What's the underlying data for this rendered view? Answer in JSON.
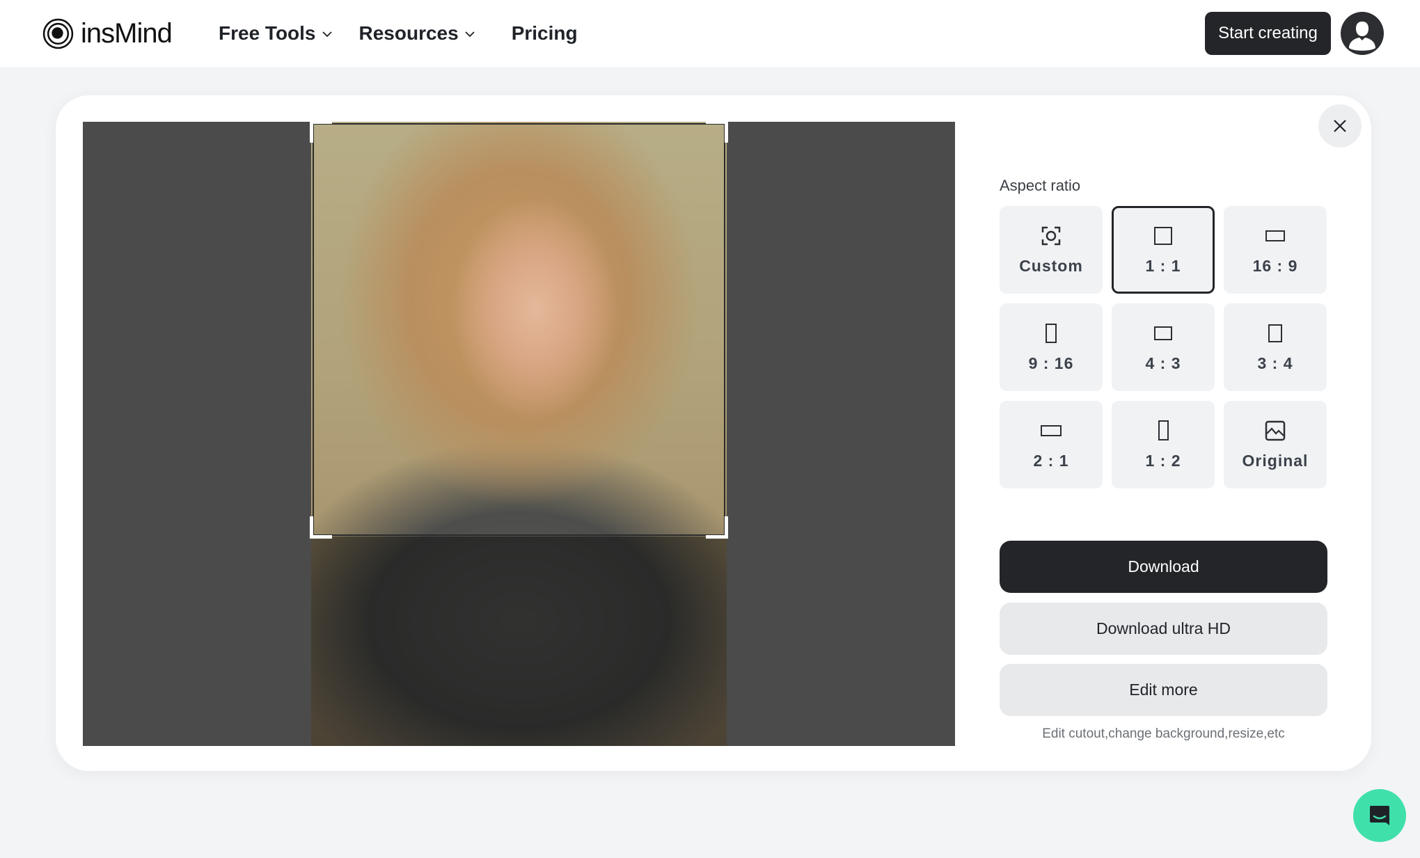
{
  "header": {
    "brand": "insMind",
    "nav": [
      {
        "label": "Free Tools",
        "has_dropdown": true
      },
      {
        "label": "Resources",
        "has_dropdown": true
      },
      {
        "label": "Pricing",
        "has_dropdown": false
      }
    ],
    "cta_label": "Start creating",
    "avatar_icon": "user-avatar-icon"
  },
  "editor": {
    "image_alt": "Smiling woman with wavy blonde hair in a grassy field, wearing a dark gray shirt",
    "selected_ratio": "1 : 1",
    "close_icon": "close-icon"
  },
  "panel": {
    "aspect_label": "Aspect ratio",
    "ratios": [
      {
        "label": "Custom",
        "icon": "custom-crop-icon"
      },
      {
        "label": "1 : 1",
        "icon": "square-icon",
        "selected": true
      },
      {
        "label": "16 : 9",
        "icon": "landscape-16-9-icon"
      },
      {
        "label": "9 : 16",
        "icon": "portrait-9-16-icon"
      },
      {
        "label": "4 : 3",
        "icon": "landscape-4-3-icon"
      },
      {
        "label": "3 : 4",
        "icon": "portrait-3-4-icon"
      },
      {
        "label": "2 : 1",
        "icon": "landscape-2-1-icon"
      },
      {
        "label": "1 : 2",
        "icon": "portrait-1-2-icon"
      },
      {
        "label": "Original",
        "icon": "image-icon"
      }
    ],
    "download_label": "Download",
    "download_hd_label": "Download ultra HD",
    "edit_more_label": "Edit more",
    "hint": "Edit cutout,change background,resize,etc"
  },
  "chat": {
    "icon": "chat-support-icon"
  },
  "colors": {
    "primary_dark": "#232528",
    "canvas_bg": "#4b4b4b",
    "tile_bg": "#f1f2f4",
    "chat_accent": "#3fe0aa",
    "page_bg": "#f3f4f6"
  }
}
